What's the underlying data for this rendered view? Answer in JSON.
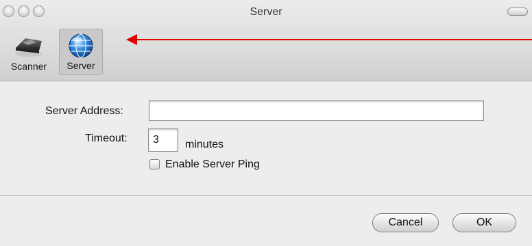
{
  "window": {
    "title": "Server"
  },
  "toolbar": {
    "items": [
      {
        "label": "Scanner",
        "icon": "scanner-icon"
      },
      {
        "label": "Server",
        "icon": "globe-icon",
        "selected": true
      }
    ]
  },
  "annotation": {
    "arrow_color": "#e00000"
  },
  "form": {
    "server_address_label": "Server Address:",
    "server_address_value": "",
    "timeout_label": "Timeout:",
    "timeout_value": "3",
    "timeout_unit": "minutes",
    "enable_ping_label": "Enable Server Ping",
    "enable_ping_checked": false
  },
  "buttons": {
    "cancel": "Cancel",
    "ok": "OK"
  }
}
